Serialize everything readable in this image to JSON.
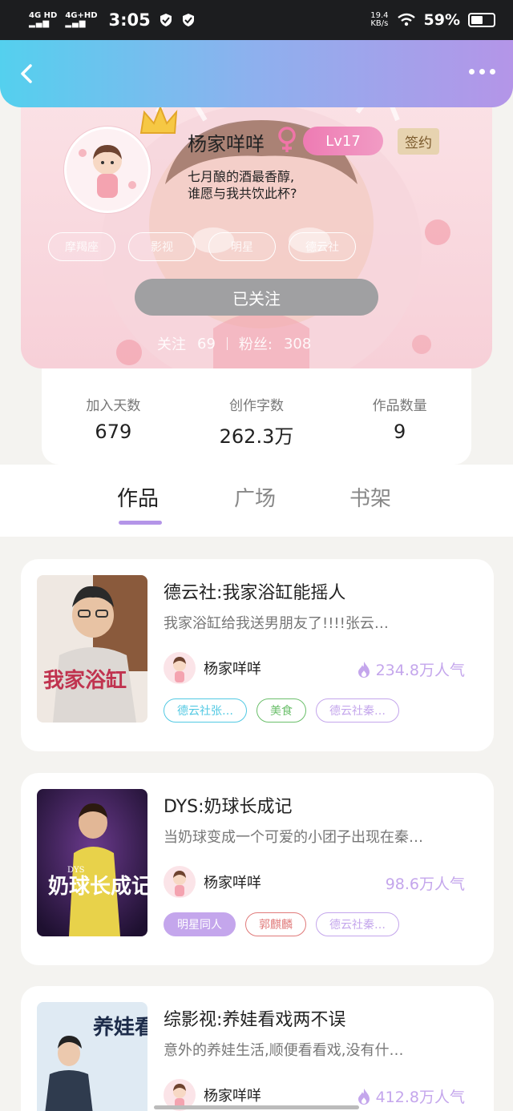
{
  "status_bar": {
    "net1": "4G HD",
    "net2": "4G+HD",
    "time": "3:05",
    "speed_value": "19.4",
    "speed_unit": "KB/s",
    "battery": "59%"
  },
  "header": {
    "back_icon": "chevron-left-icon",
    "more_icon": "more-dots-icon"
  },
  "profile": {
    "nickname": "杨家咩咩",
    "gender_symbol": "♀",
    "level": "Lv17",
    "signed_badge": "签约",
    "bio_line1": "七月酿的酒最香醇,",
    "bio_line2": "谁愿与我共饮此杯?",
    "tags": [
      "摩羯座",
      "影视",
      "明星",
      "德云社"
    ],
    "follow_button": "已关注",
    "following_label": "关注",
    "following_count": "69",
    "fans_label": "粉丝:",
    "fans_count": "308"
  },
  "stats": [
    {
      "label": "加入天数",
      "value": "679"
    },
    {
      "label": "创作字数",
      "value": "262.3万"
    },
    {
      "label": "作品数量",
      "value": "9"
    }
  ],
  "tabs": [
    "作品",
    "广场",
    "书架"
  ],
  "works": [
    {
      "title": "德云社:我家浴缸能摇人",
      "desc": "我家浴缸给我送男朋友了!!!!张云…",
      "author": "杨家咩咩",
      "popularity": "234.8万人气",
      "cover_text": "我家浴缸",
      "tags": [
        {
          "label": "德云社张…",
          "color": "#52c9e3",
          "filled": false
        },
        {
          "label": "美食",
          "color": "#6bbf6b",
          "filled": false
        },
        {
          "label": "德云社秦…",
          "color": "#c4a6ec",
          "filled": false
        }
      ]
    },
    {
      "title": "DYS:奶球长成记",
      "desc": "当奶球变成一个可爱的小团子出现在秦…",
      "author": "杨家咩咩",
      "popularity": "98.6万人气",
      "cover_text": "奶球长成记",
      "cover_small": "DYS",
      "tags": [
        {
          "label": "明星同人",
          "color": "#c4a6ec",
          "filled": true
        },
        {
          "label": "郭麒麟",
          "color": "#e07a7a",
          "filled": false
        },
        {
          "label": "德云社秦…",
          "color": "#c4a6ec",
          "filled": false
        }
      ]
    },
    {
      "title": "综影视:养娃看戏两不误",
      "desc": "意外的养娃生活,顺便看看戏,没有什…",
      "author": "杨家咩咩",
      "popularity": "412.8万人气",
      "cover_text": "养娃看戏两不误",
      "tags": []
    }
  ],
  "colors": {
    "accent_purple": "#b495e8",
    "header_start": "#54d0ee",
    "popularity": "#c4a6ec"
  }
}
